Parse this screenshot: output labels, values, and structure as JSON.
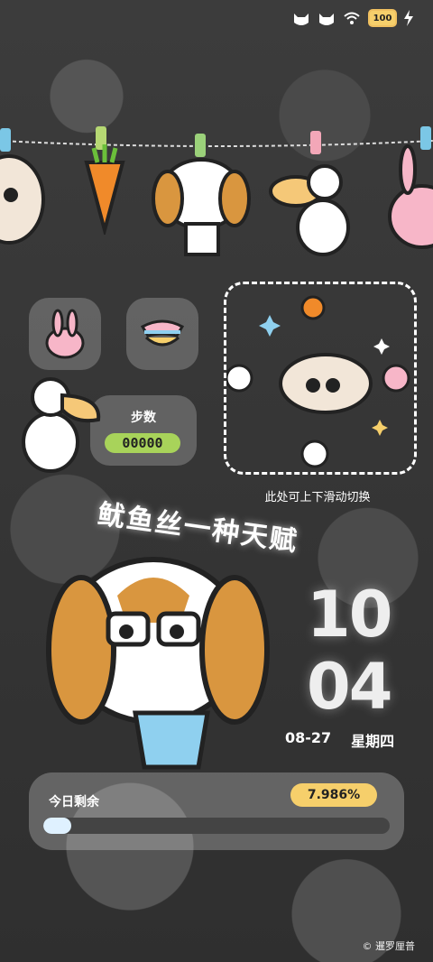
{
  "status_bar": {
    "icons": [
      "cat-face-icon",
      "cat-face-icon",
      "wifi-icon",
      "battery-icon",
      "charging-bolt-icon"
    ],
    "battery_level": "100"
  },
  "widgets": {
    "steps": {
      "label": "步数",
      "value": "00000"
    },
    "swipe_hint": "此处可上下滑动切换"
  },
  "slogan": "鱿鱼丝一种天赋",
  "clock": {
    "hour": "10",
    "minute": "04",
    "date": "08-27",
    "weekday": "星期四"
  },
  "today_remaining": {
    "label": "今日剩余",
    "percent_text": "7.986%",
    "percent": 7.986
  },
  "credit": "© 暹罗厘普",
  "colors": {
    "accent_yellow": "#f6cf6b",
    "steps_green": "#a8d35a"
  }
}
